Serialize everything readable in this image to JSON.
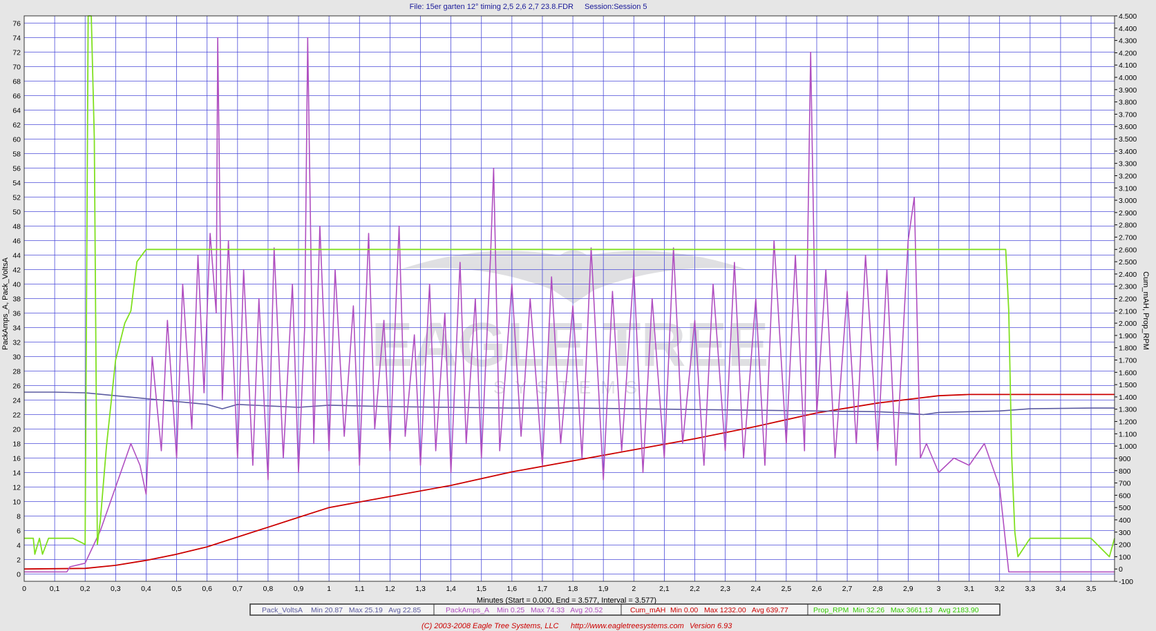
{
  "header": {
    "file_label": "File: 15er garten 12° timing 2,5 2,6 2,7 23.8.FDR",
    "session_label": "Session:Session 5"
  },
  "footer": {
    "copyright": "(C) 2003-2008 Eagle Tree Systems, LLC",
    "url": "http://www.eagletreesystems.com",
    "version": "Version 6.93"
  },
  "watermark": {
    "text": "EAGLE TREE",
    "subtext": "SYSTEMS"
  },
  "colors": {
    "background": "#e6e6e6",
    "plot_bg": "#ffffff",
    "grid": "#4a4ad8",
    "volts": "#5a5aa0",
    "amps": "#b04fc0",
    "mah": "#cc0000",
    "rpm": "#80e020",
    "title": "#1a1a99",
    "footer": "#cc0000"
  },
  "chart_data": {
    "type": "line",
    "xlabel": "Minutes (Start = 0.000, End = 3.577, Interval = 3.577)",
    "ylabel_left": "PackAmps_A, Pack_VoltsA",
    "ylabel_right": "Cum_mAH, Prop_RPM",
    "x_range": [
      0,
      3.577
    ],
    "y_left_range": [
      -1,
      77
    ],
    "y_right_range": [
      -100,
      4500
    ],
    "x_ticks": [
      "0",
      "0,1",
      "0,2",
      "0,3",
      "0,4",
      "0,5",
      "0,6",
      "0,7",
      "0,8",
      "0,9",
      "1",
      "1,1",
      "1,2",
      "1,3",
      "1,4",
      "1,5",
      "1,6",
      "1,7",
      "1,8",
      "1,9",
      "2",
      "2,1",
      "2,2",
      "2,3",
      "2,4",
      "2,5",
      "2,6",
      "2,7",
      "2,8",
      "2,9",
      "3",
      "3,1",
      "3,2",
      "3,3",
      "3,4",
      "3,5"
    ],
    "y_left_ticks": [
      "0",
      "2",
      "4",
      "6",
      "8",
      "10",
      "12",
      "14",
      "16",
      "18",
      "20",
      "22",
      "24",
      "26",
      "28",
      "30",
      "32",
      "34",
      "36",
      "38",
      "40",
      "42",
      "44",
      "46",
      "48",
      "50",
      "52",
      "54",
      "56",
      "58",
      "60",
      "62",
      "64",
      "66",
      "68",
      "70",
      "72",
      "74",
      "76"
    ],
    "y_right_ticks": [
      "-100",
      "0",
      "100",
      "200",
      "300",
      "400",
      "500",
      "600",
      "700",
      "800",
      "900",
      "1.000",
      "1.100",
      "1.200",
      "1.300",
      "1.400",
      "1.500",
      "1.600",
      "1.700",
      "1.800",
      "1.900",
      "2.000",
      "2.100",
      "2.200",
      "2.300",
      "2.400",
      "2.500",
      "2.600",
      "2.700",
      "2.800",
      "2.900",
      "3.000",
      "3.100",
      "3.200",
      "3.300",
      "3.400",
      "3.500",
      "3.600",
      "3.700",
      "3.800",
      "3.900",
      "4.000",
      "4.100",
      "4.200",
      "4.300",
      "4.400",
      "4.500"
    ],
    "grid": true,
    "legend_position": "bottom",
    "series": [
      {
        "name": "Pack_VoltsA",
        "axis": "left",
        "stats": "Min 20.87   Max 25.19   Avg 22.85",
        "x": [
          0,
          0.1,
          0.2,
          0.3,
          0.35,
          0.4,
          0.5,
          0.6,
          0.65,
          0.7,
          0.8,
          0.9,
          1.0,
          1.2,
          1.4,
          1.6,
          1.8,
          2.0,
          2.2,
          2.4,
          2.6,
          2.8,
          2.9,
          2.95,
          3.0,
          3.1,
          3.2,
          3.3,
          3.5,
          3.577
        ],
        "y": [
          25.1,
          25.1,
          25.0,
          24.6,
          24.4,
          24.2,
          23.8,
          23.4,
          22.8,
          23.4,
          23.2,
          23.0,
          23.3,
          23.1,
          23.0,
          22.9,
          22.9,
          22.8,
          22.7,
          22.6,
          22.5,
          22.4,
          22.2,
          22.0,
          22.3,
          22.4,
          22.5,
          22.8,
          22.9,
          22.9
        ]
      },
      {
        "name": "PackAmps_A",
        "axis": "left",
        "stats": "Min 0.25   Max 74.33   Avg 20.52",
        "x": [
          0,
          0.14,
          0.15,
          0.2,
          0.25,
          0.3,
          0.35,
          0.38,
          0.4,
          0.42,
          0.45,
          0.47,
          0.5,
          0.52,
          0.55,
          0.57,
          0.59,
          0.61,
          0.63,
          0.635,
          0.65,
          0.67,
          0.7,
          0.72,
          0.75,
          0.77,
          0.8,
          0.82,
          0.85,
          0.88,
          0.9,
          0.92,
          0.93,
          0.95,
          0.97,
          1.0,
          1.02,
          1.05,
          1.08,
          1.1,
          1.13,
          1.15,
          1.18,
          1.2,
          1.23,
          1.25,
          1.28,
          1.3,
          1.33,
          1.35,
          1.38,
          1.4,
          1.43,
          1.45,
          1.48,
          1.5,
          1.53,
          1.54,
          1.56,
          1.6,
          1.63,
          1.66,
          1.7,
          1.73,
          1.76,
          1.8,
          1.83,
          1.86,
          1.9,
          1.93,
          1.96,
          2.0,
          2.03,
          2.06,
          2.1,
          2.13,
          2.16,
          2.2,
          2.23,
          2.26,
          2.3,
          2.33,
          2.36,
          2.4,
          2.43,
          2.46,
          2.5,
          2.53,
          2.56,
          2.58,
          2.6,
          2.63,
          2.66,
          2.7,
          2.73,
          2.76,
          2.8,
          2.83,
          2.86,
          2.9,
          2.92,
          2.94,
          2.96,
          3.0,
          3.05,
          3.1,
          3.15,
          3.2,
          3.23,
          3.5,
          3.577
        ],
        "y": [
          0.3,
          0.3,
          1.0,
          1.5,
          6,
          12,
          18,
          15,
          11,
          30,
          17,
          35,
          16,
          40,
          20,
          44,
          25,
          47,
          36,
          74,
          24,
          46,
          16,
          42,
          15,
          38,
          13,
          45,
          16,
          40,
          14,
          34,
          74,
          18,
          48,
          17,
          42,
          19,
          37,
          15,
          47,
          20,
          35,
          17,
          48,
          19,
          33,
          15,
          40,
          17,
          36,
          14,
          43,
          18,
          38,
          16,
          44,
          56,
          17,
          40,
          19,
          38,
          15,
          41,
          18,
          37,
          16,
          45,
          13,
          39,
          17,
          42,
          14,
          38,
          16,
          45,
          18,
          35,
          15,
          40,
          17,
          43,
          16,
          38,
          15,
          46,
          18,
          44,
          17,
          72,
          22,
          42,
          16,
          39,
          18,
          44,
          17,
          42,
          15,
          46,
          52,
          16,
          18,
          14,
          16,
          15,
          18,
          12,
          0.3,
          0.3,
          0.3
        ]
      },
      {
        "name": "Cum_mAH",
        "axis": "right",
        "stats": "Min 0.00   Max 1232.00   Avg 639.77",
        "x": [
          0,
          0.2,
          0.3,
          0.4,
          0.5,
          0.6,
          0.7,
          0.8,
          0.9,
          1.0,
          1.2,
          1.4,
          1.6,
          1.8,
          2.0,
          2.2,
          2.4,
          2.6,
          2.8,
          2.9,
          3.0,
          3.1,
          3.2,
          3.25,
          3.577
        ],
        "y": [
          0,
          5,
          30,
          70,
          120,
          180,
          260,
          340,
          420,
          500,
          590,
          680,
          790,
          880,
          970,
          1060,
          1160,
          1270,
          1350,
          1380,
          1410,
          1420,
          1420,
          1420,
          1420
        ]
      },
      {
        "name": "Prop_RPM",
        "axis": "right",
        "stats": "Min 32.26   Max 3661.13   Avg 2183.90",
        "x": [
          0,
          0.03,
          0.035,
          0.05,
          0.06,
          0.08,
          0.1,
          0.15,
          0.16,
          0.2,
          0.21,
          0.22,
          0.23,
          0.24,
          0.25,
          0.27,
          0.3,
          0.33,
          0.35,
          0.37,
          0.4,
          0.5,
          0.6,
          0.7,
          0.8,
          0.9,
          1.0,
          1.2,
          1.4,
          1.6,
          1.8,
          2.0,
          2.2,
          2.4,
          2.6,
          2.8,
          3.0,
          3.1,
          3.2,
          3.22,
          3.23,
          3.24,
          3.25,
          3.26,
          3.3,
          3.4,
          3.5,
          3.56,
          3.577
        ],
        "y": [
          250,
          250,
          120,
          250,
          120,
          250,
          250,
          250,
          250,
          200,
          4500,
          4500,
          3500,
          200,
          400,
          1000,
          1700,
          2000,
          2100,
          2500,
          2600,
          2600,
          2600,
          2600,
          2600,
          2600,
          2600,
          2600,
          2600,
          2600,
          2600,
          2600,
          2600,
          2600,
          2600,
          2600,
          2600,
          2600,
          2600,
          2600,
          2100,
          900,
          300,
          100,
          250,
          250,
          250,
          100,
          250
        ]
      }
    ]
  }
}
